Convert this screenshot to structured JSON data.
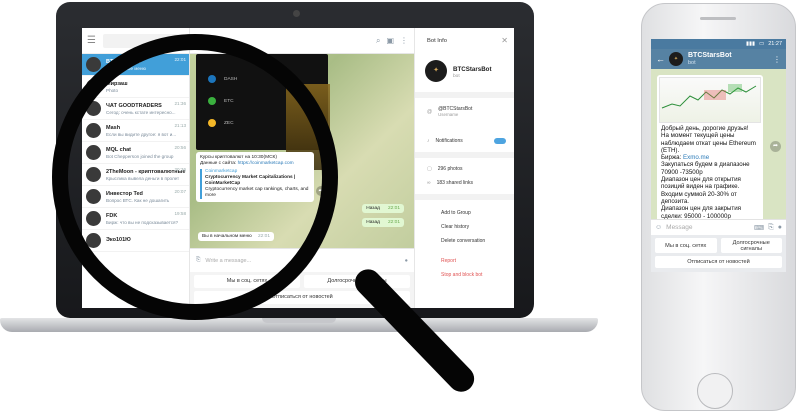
{
  "desktop": {
    "chat_list": [
      {
        "name": "BTCStarsBot",
        "sub": "В начальное меню",
        "meta": "22:01",
        "active": true
      },
      {
        "name": "Мирзаш",
        "sub": "Photo",
        "meta": "",
        "active": false
      },
      {
        "name": "ЧАТ GOODTRADERS",
        "sub": "Сегод: очень кстате интересно...",
        "meta": "21:36",
        "active": false
      },
      {
        "name": "Mash",
        "sub": "Если вы видите другое: я вот и...",
        "meta": "21:13",
        "active": false
      },
      {
        "name": "MQL chat",
        "sub": "Bot Chepperson joined the group",
        "meta": "20:56",
        "active": false
      },
      {
        "name": "2TheMoon - криптовалютные",
        "sub": "Крыслика вывела деньги в пролет",
        "meta": "20:36",
        "active": false
      },
      {
        "name": "Инвестор Ted",
        "sub": "Вопрос ВТС. Как не дошагить",
        "meta": "20:07",
        "active": false
      },
      {
        "name": "FDK",
        "sub": "Бирж: что вы не подсказывается?",
        "meta": "19:58",
        "active": false
      },
      {
        "name": "Эко101Ю",
        "sub": "",
        "meta": "",
        "active": false
      }
    ],
    "coins": [
      {
        "sym": "DASH",
        "color": "#1c75bc"
      },
      {
        "sym": "ETC",
        "color": "#3ab03e"
      },
      {
        "sym": "ZEC",
        "color": "#f4b728"
      }
    ],
    "bubble": {
      "line1": "Курсы криптовалют на 10:30(МСК)",
      "line2": "Данные с сайта:",
      "link": "https://coinmarketcap.com",
      "site": "Coinmarketcap",
      "card_title": "Cryptocurrency Market Capitalizations | CoinMarketCap",
      "card_desc": "Cryptocurrency market cap rankings, charts, and more"
    },
    "out_messages": [
      {
        "text": "Назад",
        "time": "22:01"
      },
      {
        "text": "Назад",
        "time": "22:01"
      }
    ],
    "in_small": {
      "text": "Вы в начальном меню",
      "time": "22:01"
    },
    "input_placeholder": "Write a message...",
    "keyboard": [
      [
        "Мы в соц. сетях",
        "Долгосрочные сигналы"
      ],
      [
        "Отписаться от новостей"
      ]
    ],
    "info": {
      "title": "Bot Info",
      "name": "BTCStarsBot",
      "sub": "bot",
      "username": "@BTCStarsBot",
      "username_label": "Username",
      "notifications": "Notifications",
      "photos": "296 photos",
      "links": "183 shared links",
      "actions": [
        "Add to Group",
        "Clear history",
        "Delete conversation"
      ],
      "danger": [
        "Report",
        "Stop and block bot"
      ]
    }
  },
  "phone": {
    "status_time": "21:27",
    "title": "BTCStarsBot",
    "sub": "bot",
    "message": {
      "l1": "Добрый день, дорогие друзья!",
      "l2": "На момент текущей цены наблюдаем откат цены Ethereum (ETH).",
      "birzha_label": "Биржа:",
      "birzha_link": "Exmo.me",
      "l3": "Закупаться будем в диапазоне 70900 -73500р",
      "l4": "Диапазон цен для открытия позиций виден на графике.",
      "l5": "Входим суммой 20-30% от депозита.",
      "l6": "Диапазон цен для закрытия сделки: 95000 - 100000р"
    },
    "input_placeholder": "Message",
    "keyboard": [
      [
        "Мы в соц. сетях",
        "Долгосрочные сигналы"
      ],
      [
        "Отписаться от новостей"
      ]
    ]
  }
}
